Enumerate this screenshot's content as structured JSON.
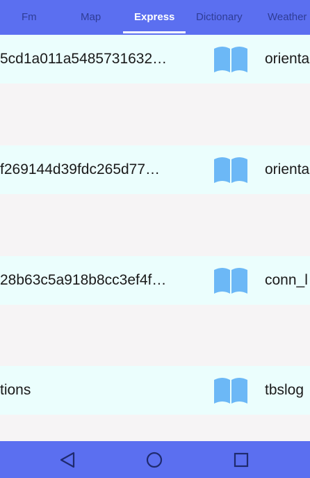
{
  "tabs": [
    {
      "label": "Fm",
      "active": false
    },
    {
      "label": "Map",
      "active": false
    },
    {
      "label": "Express",
      "active": true
    },
    {
      "label": "Dictionary",
      "active": false
    },
    {
      "label": "Weather",
      "active": false
    }
  ],
  "rows": [
    {
      "title": "5cd1a011a5485731632…",
      "tag": "orienta",
      "icon": "open-book-icon"
    },
    {
      "title": "f269144d39fdc265d77…",
      "tag": "orienta",
      "icon": "open-book-icon"
    },
    {
      "title": "28b63c5a918b8cc3ef4f…",
      "tag": "conn_l",
      "icon": "open-book-icon"
    },
    {
      "title": "tions",
      "tag": "tbslog",
      "icon": "open-book-icon"
    }
  ],
  "nav": {
    "back_icon": "back-triangle-icon",
    "home_icon": "home-circle-icon",
    "recents_icon": "recents-square-icon"
  },
  "colors": {
    "bar": "#5b6ff0",
    "tab_inactive": "#2f3d96",
    "row_bg": "#ebfefd",
    "gap_bg": "#f6f4f5",
    "icon": "#6cb8f6"
  }
}
